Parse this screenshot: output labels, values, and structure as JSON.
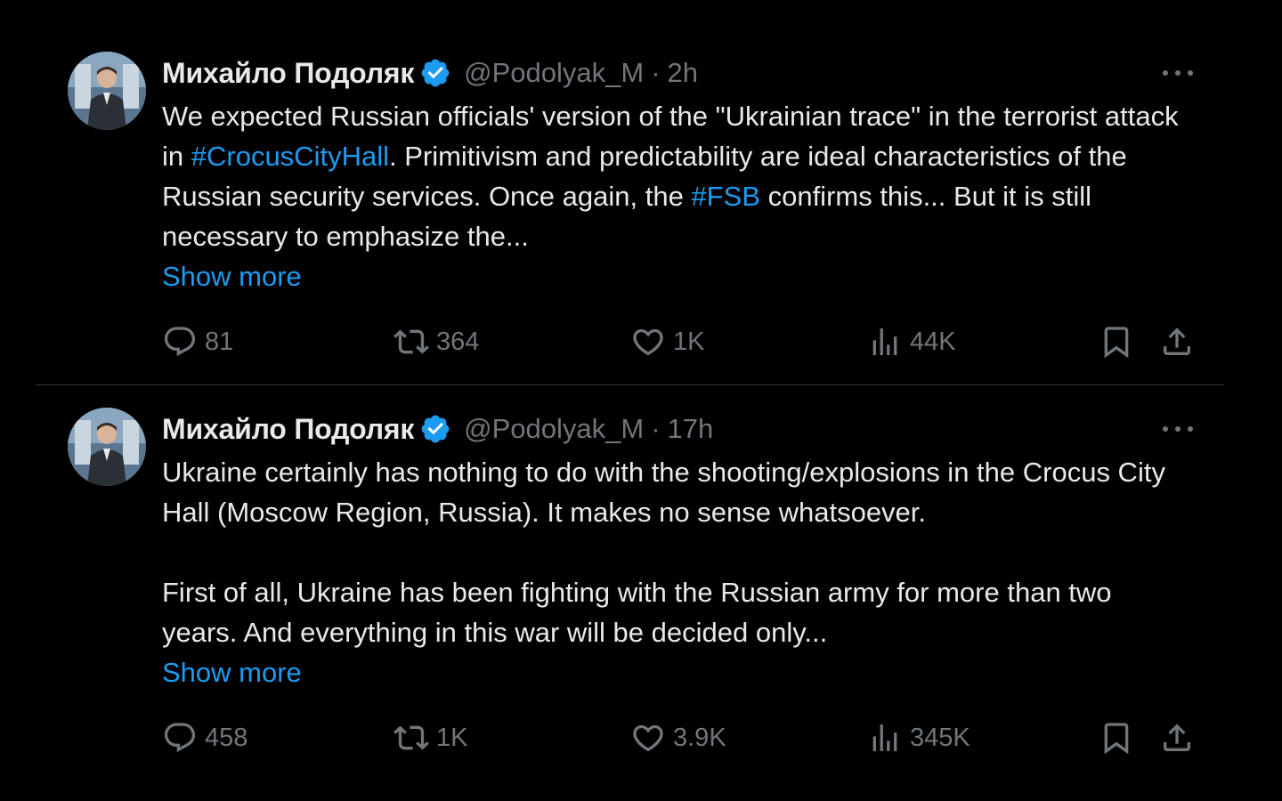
{
  "tweets": [
    {
      "author_name": "Михайло Подоляк",
      "handle": "@Podolyak_M",
      "separator": "·",
      "time": "2h",
      "body_part1": "We expected Russian officials' version of the \"Ukrainian trace\" in the terrorist attack in ",
      "hashtag1": "#CrocusCityHall",
      "body_part2": ". Primitivism and predictability are ideal characteristics of the Russian security services. Once again, the ",
      "hashtag2": "#FSB",
      "body_part3": " confirms this... But it is still necessary to emphasize the...",
      "show_more": "Show more",
      "replies": "81",
      "retweets": "364",
      "likes": "1K",
      "views": "44K"
    },
    {
      "author_name": "Михайло Подоляк",
      "handle": "@Podolyak_M",
      "separator": "·",
      "time": "17h",
      "body_text": "Ukraine certainly has nothing to do with the shooting/explosions in the Crocus City Hall (Moscow Region, Russia). It makes no sense whatsoever.\n\nFirst of all, Ukraine has been fighting with the Russian army for more than two years. And everything in this war will be decided only...",
      "show_more": "Show more",
      "replies": "458",
      "retweets": "1K",
      "likes": "3.9K",
      "views": "345K"
    }
  ],
  "colors": {
    "background": "#000000",
    "text": "#e7e9ea",
    "muted": "#71767b",
    "accent": "#1d9bf0",
    "divider": "#2f3336"
  },
  "icons": [
    "verified-badge-icon",
    "more-icon",
    "reply-icon",
    "retweet-icon",
    "like-icon",
    "views-icon",
    "bookmark-icon",
    "share-icon"
  ]
}
